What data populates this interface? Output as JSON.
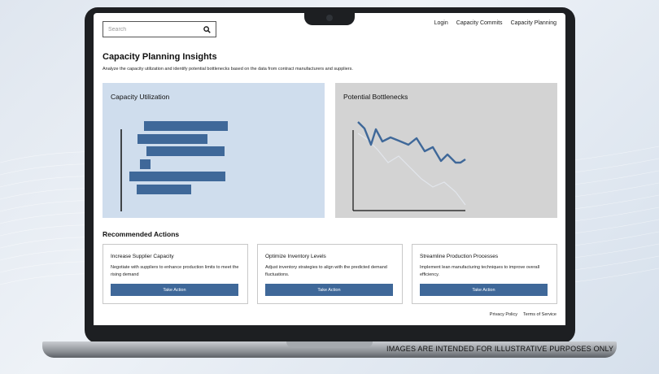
{
  "search": {
    "placeholder": "Search",
    "icon": "search-icon"
  },
  "nav": {
    "items": [
      "Login",
      "Capacity Commits",
      "Capacity Planning"
    ]
  },
  "page": {
    "title": "Capacity Planning Insights",
    "subtitle": "Analyze the capacity utilization and identify potential bottlenecks based on the data from contract manufacturers and suppliers."
  },
  "cards": {
    "utilization": {
      "title": "Capacity Utilization",
      "bg": "#cfdded",
      "bar_color": "#3f6899"
    },
    "bottlenecks": {
      "title": "Potential Bottlenecks",
      "bg": "#d3d3d3",
      "line_color": "#3f6899"
    }
  },
  "recommended": {
    "title": "Recommended Actions",
    "actions": [
      {
        "title": "Increase Supplier Capacity",
        "desc": "Negotiate with suppliers to enhance production limits to meet the rising demand",
        "button": "Take Action"
      },
      {
        "title": "Optimize Inventory Levels",
        "desc": "Adjust inventory strategies to align with the predicted demand fluctuations.",
        "button": "Take Action"
      },
      {
        "title": "Streamline Production Processes",
        "desc": "Implement lean manufacturing techniques to improve overall efficiency.",
        "button": "Take Action"
      }
    ]
  },
  "footer": {
    "links": [
      "Privacy Policy",
      "Terms of Service"
    ]
  },
  "disclaimer": "IMAGES ARE INTENDED FOR ILLUSTRATIVE PURPOSES ONLY",
  "colors": {
    "accent": "#3f6899",
    "lid": "#1d1f22"
  }
}
